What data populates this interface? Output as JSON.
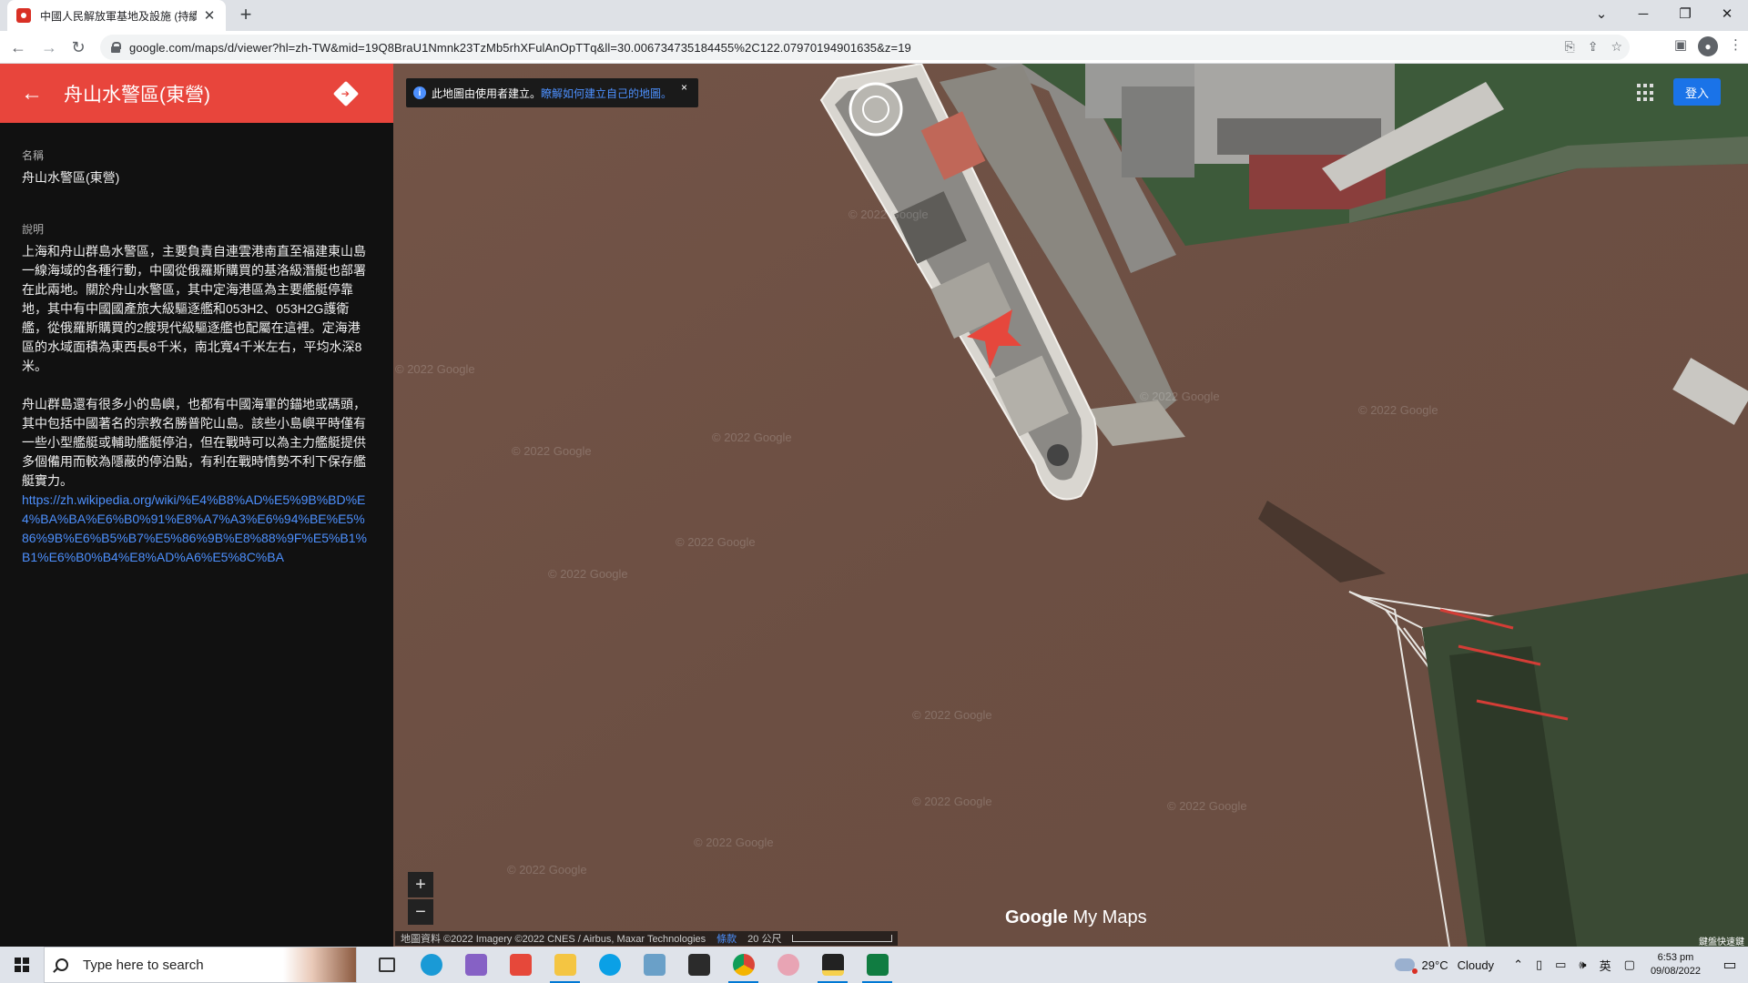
{
  "browser": {
    "tab_title": "中國人民解放軍基地及設施 (持續",
    "url": "google.com/maps/d/viewer?hl=zh-TW&mid=19Q8BraU1Nmnk23TzMb5rhXFulAnOpTTq&ll=30.006734735184455%2C122.07970194901635&z=19"
  },
  "sidebar": {
    "title": "舟山水警區(東營)",
    "name_label": "名稱",
    "name_value": "舟山水警區(東營)",
    "desc_label": "說明",
    "desc_p1": "上海和舟山群島水警區，主要負責自連雲港南直至福建東山島一線海域的各種行動，中國從俄羅斯購買的基洛級潛艇也部署在此兩地。關於舟山水警區，其中定海港區為主要艦艇停靠地，其中有中國國產旅大級驅逐艦和053H2、053H2G護衛艦，從俄羅斯購買的2艘現代級驅逐艦也配屬在這裡。定海港區的水域面積為東西長8千米，南北寬4千米左右，平均水深8米。",
    "desc_p2": "舟山群島還有很多小的島嶼，也都有中國海軍的錨地或碼頭，其中包括中國著名的宗教名勝普陀山島。該些小島嶼平時僅有一些小型艦艇或輔助艦艇停泊，但在戰時可以為主力艦艇提供多個備用而較為隱蔽的停泊點，有利在戰時情勢不利下保存艦艇實力。",
    "wiki_link": "https://zh.wikipedia.org/wiki/%E4%B8%AD%E5%9B%BD%E4%BA%BA%E6%B0%91%E8%A7%A3%E6%94%BE%E5%86%9B%E6%B5%B7%E5%86%9B%E8%88%9F%E5%B1%B1%E6%B0%B4%E8%AD%A6%E5%8C%BA"
  },
  "map": {
    "notice_text": "此地圖由使用者建立。",
    "notice_link": "瞭解如何建立自己的地圖。",
    "notice_close": "×",
    "signin_label": "登入",
    "zoom_in": "+",
    "zoom_out": "−",
    "logo_google": "Google",
    "logo_mymaps": "My Maps",
    "attribution": "地圖資料 ©2022 Imagery ©2022 CNES / Airbus, Maxar Technologies",
    "terms": "條款",
    "scale": "20 公尺",
    "corner_text": "鍵盤快速鍵",
    "watermark": "© 2022 Google",
    "water_color": "#6e5044",
    "accent_color": "#e8453c"
  },
  "taskbar": {
    "search_placeholder": "Type here to search",
    "weather_temp": "29°C",
    "weather_desc": "Cloudy",
    "ime": "英",
    "time": "6:53 pm",
    "date": "09/08/2022"
  }
}
